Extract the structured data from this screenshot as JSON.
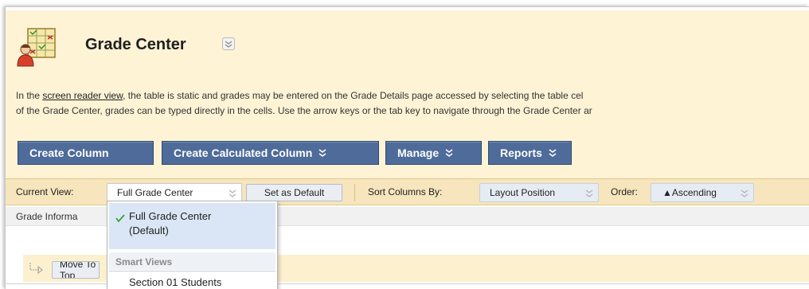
{
  "header": {
    "title": "Grade Center",
    "description": {
      "line1_prefix": "In the ",
      "link": "screen reader view",
      "line1_suffix": ", the table is static and grades may be entered on the Grade Details page accessed by selecting the table cel",
      "line2": "of the Grade Center, grades can be typed directly in the cells. Use the arrow keys or the tab key to navigate through the Grade Center ar"
    }
  },
  "action_bar": {
    "create_column": "Create Column",
    "create_calculated_column": "Create Calculated Column",
    "manage": "Manage",
    "reports": "Reports"
  },
  "view_bar": {
    "current_view_label": "Current View:",
    "current_view_value": "Full Grade Center",
    "set_default": "Set as Default",
    "sort_label": "Sort Columns By:",
    "sort_value": "Layout Position",
    "order_label": "Order:",
    "order_value": "▲Ascending"
  },
  "grade_info_label": "Grade Informa",
  "move_button": "Move To Top",
  "view_dropdown": {
    "selected_line1": "Full Grade Center",
    "selected_line2": "(Default)",
    "group_label": "Smart Views",
    "items": [
      "Section 01 Students"
    ]
  },
  "colors": {
    "header_bg": "#fff3d6",
    "action_button": "#4e6b9a",
    "view_bar_bg": "#f6e5bd",
    "dropdown_selected": "#dae6f5",
    "check": "#3aa13a"
  }
}
